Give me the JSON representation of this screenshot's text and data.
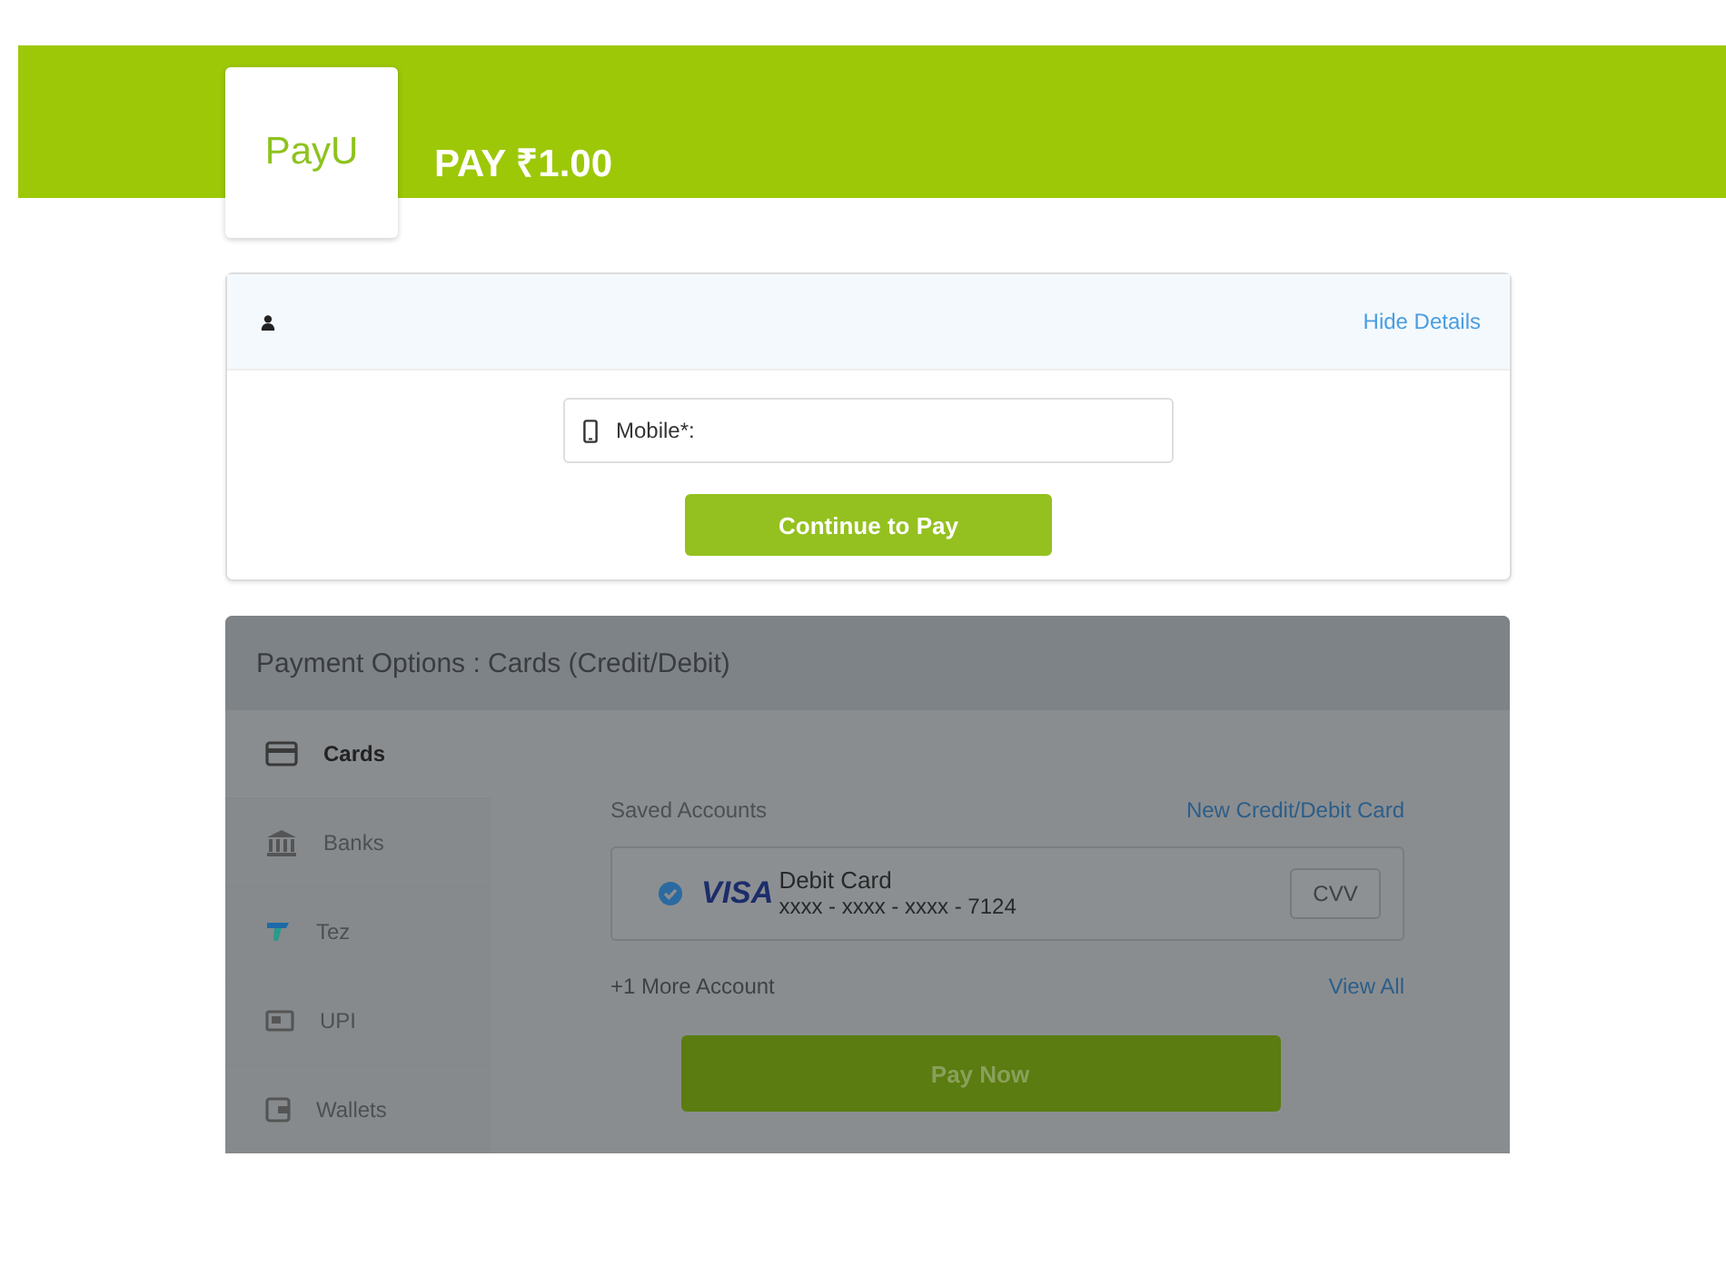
{
  "header": {
    "logo": "PayU",
    "title": "PAY ₹1.00"
  },
  "details": {
    "hide_link": "Hide Details",
    "mobile_field": {
      "placeholder": "Mobile*:"
    },
    "continue_button": "Continue to Pay"
  },
  "payment": {
    "title": "Payment Options : Cards (Credit/Debit)",
    "methods": [
      {
        "kind": "card",
        "label": "Cards",
        "selected": true
      },
      {
        "kind": "bank",
        "label": "Banks",
        "selected": false
      },
      {
        "kind": "tez",
        "label": "Tez",
        "selected": false
      },
      {
        "kind": "upi",
        "label": "UPI",
        "selected": false
      },
      {
        "kind": "wallet",
        "label": "Wallets",
        "selected": false
      }
    ],
    "saved_heading": "Saved Accounts",
    "new_card_link": "New Credit/Debit Card",
    "account": {
      "selected": true,
      "brand": "VISA",
      "type": "Debit Card",
      "number": "xxxx - xxxx - xxxx - 7124",
      "cvv_placeholder": "CVV"
    },
    "more_accounts": "+1 More Account",
    "view_all_link": "View All",
    "pay_button": "Pay Now"
  }
}
